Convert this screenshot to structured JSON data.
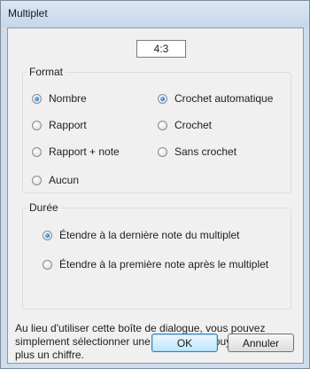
{
  "window": {
    "title": "Multiplet"
  },
  "ratio": {
    "value": "4:3"
  },
  "format": {
    "label": "Format",
    "options": [
      {
        "label": "Nombre",
        "selected": true
      },
      {
        "label": "Crochet automatique",
        "selected": true
      },
      {
        "label": "Rapport",
        "selected": false
      },
      {
        "label": "Crochet",
        "selected": false
      },
      {
        "label": "Rapport + note",
        "selected": false
      },
      {
        "label": "Sans crochet",
        "selected": false
      },
      {
        "label": "Aucun",
        "selected": false
      }
    ]
  },
  "duration": {
    "label": "Durée",
    "options": [
      {
        "label": "Étendre à la dernière note du multiplet",
        "selected": true
      },
      {
        "label": "Étendre à la première note après le multiplet",
        "selected": false
      }
    ]
  },
  "help": {
    "text": "Au lieu d'utiliser cette boîte de dialogue, vous pouvez simplement sélectionner une note, puis appuyer sur Ctrl plus un chiffre."
  },
  "buttons": {
    "ok": "OK",
    "cancel": "Annuler"
  },
  "colors": {
    "accent": "#2d7fd0",
    "frame": "#cfdcec",
    "panel": "#f0f0f0"
  }
}
